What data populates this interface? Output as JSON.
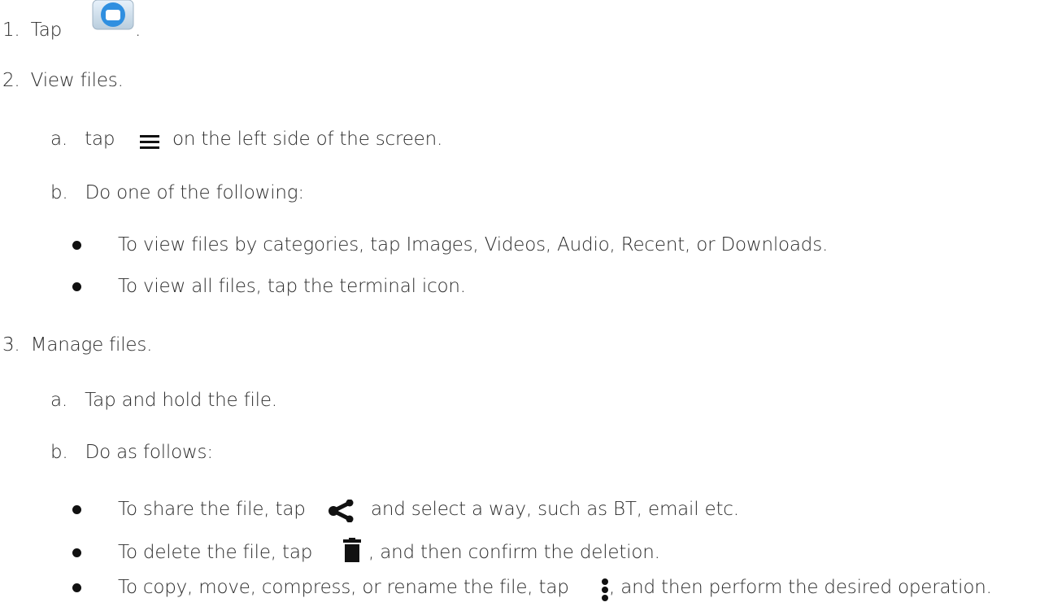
{
  "steps": [
    {
      "num": "1.",
      "pre": "Tap",
      "icon": "files-app-icon",
      "post": "."
    },
    {
      "num": "2.",
      "text": "View files.",
      "substeps": [
        {
          "letter": "a.",
          "pre": "tap",
          "icon": "menu-icon",
          "post": "on the left side of the screen."
        },
        {
          "letter": "b.",
          "text": "Do one of the following:",
          "bullets": [
            {
              "text": "To view files by categories, tap Images, Videos, Audio, Recent, or Downloads."
            },
            {
              "text": "To view all files, tap the terminal icon."
            }
          ]
        }
      ]
    },
    {
      "num": "3.",
      "text": "Manage files.",
      "substeps": [
        {
          "letter": "a.",
          "text": "Tap and hold the file."
        },
        {
          "letter": "b.",
          "text": "Do as follows:",
          "bullets": [
            {
              "pre": "To share the file, tap",
              "icon": "share-icon",
              "post": "and select a way, such as BT, email etc."
            },
            {
              "pre": "To delete the file, tap",
              "icon": "trash-icon",
              "post": ", and then confirm the deletion."
            },
            {
              "pre": "To copy, move, compress, or rename the file, tap",
              "icon": "more-vert-icon",
              "post": ", and then perform the desired operation."
            }
          ]
        }
      ]
    }
  ],
  "colors": {
    "text": "#2b2b2b",
    "icon": "#111111",
    "app_icon_blue": "#2f8fe0"
  }
}
